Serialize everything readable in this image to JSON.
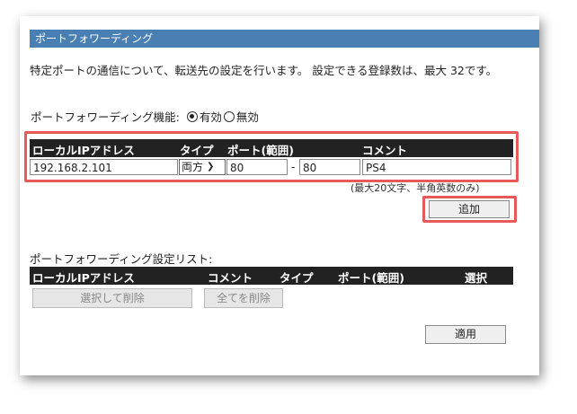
{
  "section_title": "ポートフォワーディング",
  "description": "特定ポートの通信について、転送先の設定を行います。 設定できる登録数は、最大 32です。",
  "function": {
    "label": "ポートフォワーディング機能:",
    "options": [
      "有効",
      "無効"
    ],
    "selected": "有効"
  },
  "entry_table": {
    "headers": {
      "ip": "ローカルIPアドレス",
      "type": "タイプ",
      "port": "ポート(範囲)",
      "comment": "コメント"
    },
    "ip_value": "192.168.2.101",
    "type_value": "両方",
    "port_from": "80",
    "port_separator": "-",
    "port_to": "80",
    "comment_value": "PS4",
    "note": "(最大20文字、半角英数のみ)"
  },
  "add_button": "追加",
  "list": {
    "label": "ポートフォワーディング設定リスト:",
    "headers": {
      "ip": "ローカルIPアドレス",
      "comment": "コメント",
      "type": "タイプ",
      "port": "ポート(範囲)",
      "select": "選択"
    },
    "delete_selected": "選択して削除",
    "delete_all": "全てを削除"
  },
  "apply_button": "適用",
  "colors": {
    "title_bar": "#4a7fb3",
    "highlight": "#e85a5a",
    "header_bg": "#222222"
  }
}
